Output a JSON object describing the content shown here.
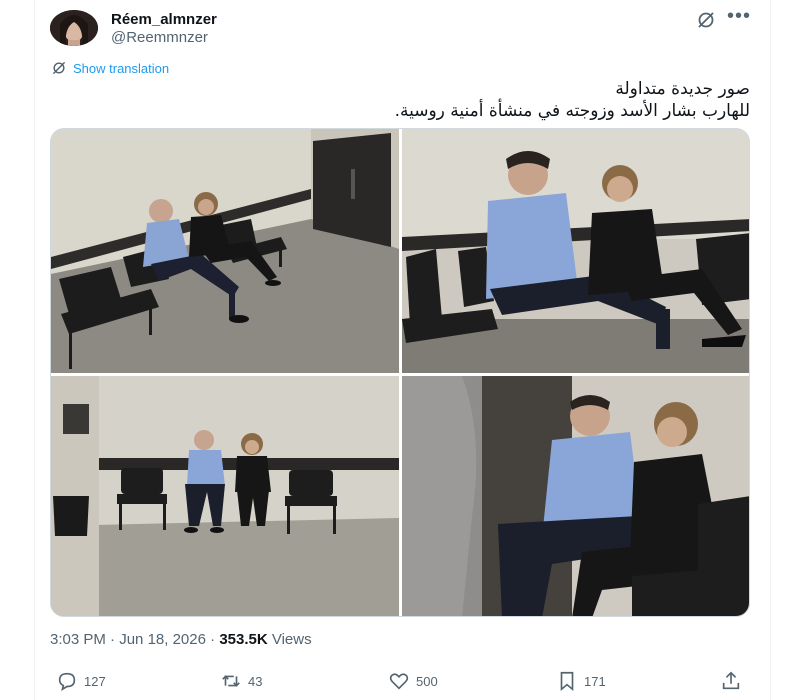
{
  "author": {
    "display_name": "Réem_almnzer",
    "handle": "@Reemmnzer"
  },
  "translate_label": "Show translation",
  "tweet_text": {
    "line1": "صور جديدة متداولة",
    "line2": "للهارب بشار الأسد وزوجته في منشأة أمنية روسية."
  },
  "media": [
    {
      "icon": "photo",
      "caption": ""
    },
    {
      "icon": "photo",
      "caption": ""
    },
    {
      "icon": "photo",
      "caption": ""
    },
    {
      "icon": "photo",
      "caption": ""
    }
  ],
  "meta": {
    "time": "3:03 PM",
    "separator1": " · ",
    "date": "Jun 18, 2026",
    "separator2": " · ",
    "views_count": "353.5K",
    "views_label": " Views"
  },
  "actions": {
    "replies": "127",
    "reposts": "43",
    "likes": "500",
    "bookmarks": "171"
  },
  "colors": {
    "accent": "#1d9bf0",
    "secondary_text": "#536471",
    "primary_text": "#0f1419"
  }
}
